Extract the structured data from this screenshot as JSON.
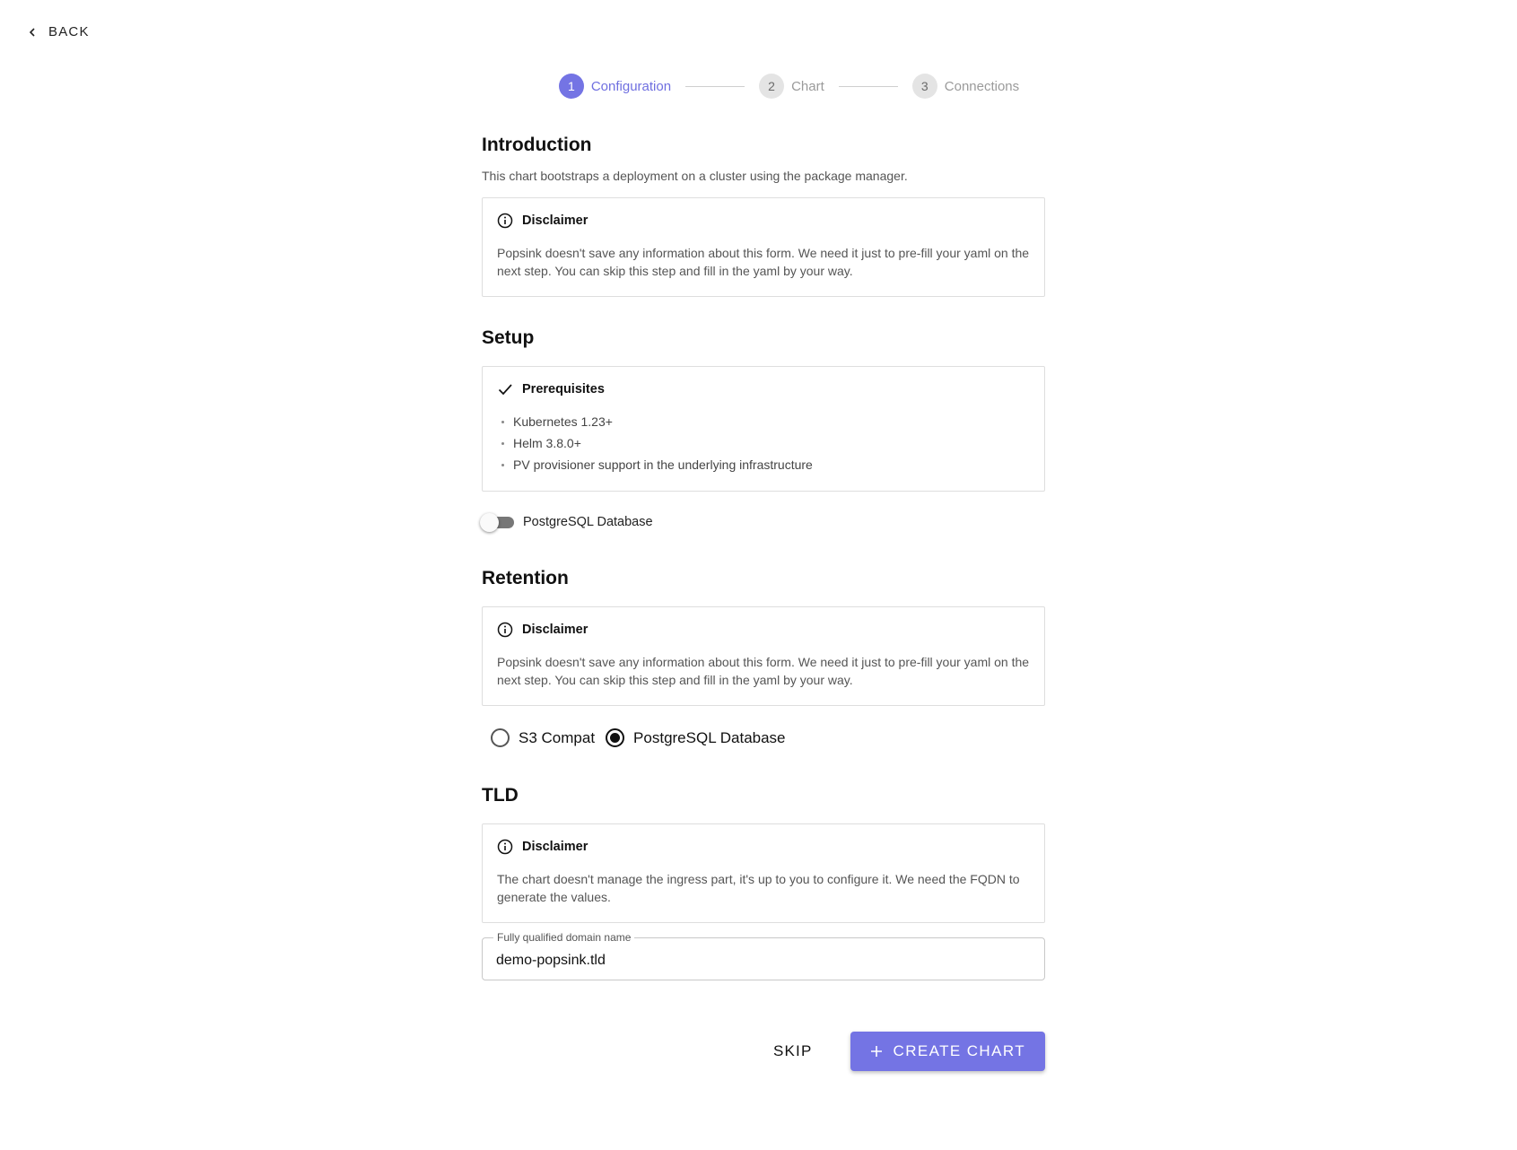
{
  "nav": {
    "back_label": "BACK"
  },
  "stepper": {
    "steps": [
      {
        "number": "1",
        "label": "Configuration"
      },
      {
        "number": "2",
        "label": "Chart"
      },
      {
        "number": "3",
        "label": "Connections"
      }
    ],
    "active_index": 0
  },
  "introduction": {
    "title": "Introduction",
    "text": "This chart bootstraps a deployment on a cluster using the package manager.",
    "disclaimer_title": "Disclaimer",
    "disclaimer_text": "Popsink doesn't save any information about this form. We need it just to pre-fill your yaml on the next step. You can skip this step and fill in the yaml by your way."
  },
  "setup": {
    "title": "Setup",
    "prereq_title": "Prerequisites",
    "prereq_items": [
      "Kubernetes 1.23+",
      "Helm 3.8.0+",
      "PV provisioner support in the underlying infrastructure"
    ],
    "toggle_label": "PostgreSQL Database",
    "toggle_on": false
  },
  "retention": {
    "title": "Retention",
    "disclaimer_title": "Disclaimer",
    "disclaimer_text": "Popsink doesn't save any information about this form. We need it just to pre-fill your yaml on the next step. You can skip this step and fill in the yaml by your way.",
    "options": [
      "S3 Compat",
      "PostgreSQL Database"
    ],
    "selected": "PostgreSQL Database"
  },
  "tld": {
    "title": "TLD",
    "disclaimer_title": "Disclaimer",
    "disclaimer_text": "The chart doesn't manage the ingress part, it's up to you to configure it. We need the FQDN to generate the values.",
    "field_label": "Fully qualified domain name",
    "field_value": "demo-popsink.tld"
  },
  "actions": {
    "skip_label": "SKIP",
    "create_label": "CREATE CHART"
  },
  "colors": {
    "accent": "#7474e4",
    "border": "#dedede"
  }
}
